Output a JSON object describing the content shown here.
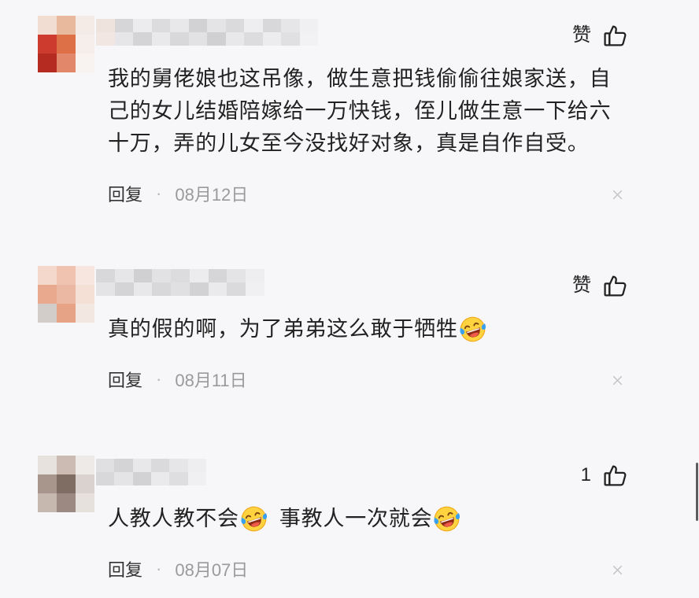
{
  "colors": {
    "background": "#f7f7f9",
    "text_primary": "#222222",
    "reply_label": "#333333",
    "text_secondary": "#9a9a9a",
    "separator": "#b5b5b5",
    "close_icon": "#c4c4c4",
    "scrollbar": "#5c5c5c"
  },
  "icons": {
    "like": "thumbs-up-icon",
    "dismiss": "close-icon",
    "emoji": "laughing-crying-emoji-icon"
  },
  "comments": [
    {
      "avatar_mosaic": [
        "#f1ddd2",
        "#e8b99c",
        "#f4ebe7",
        "#cc3b2e",
        "#de7048",
        "#f6eeeb",
        "#b52b22",
        "#e3876a",
        "#f8f3f1"
      ],
      "username_mosaic": [
        "#efe3de",
        "#d6d6d9",
        "#ececee",
        "#dcdcdf",
        "#e8e8ea",
        "#d2d2d5",
        "#e4e4e6",
        "#dadadd",
        "#eeeef0",
        "#d8d8db",
        "#e6e6e8",
        "#f0f0f2",
        "#f2e6e2",
        "#e6e6e8",
        "#d4d4d7",
        "#e9e9eb",
        "#d8d8db",
        "#e2e2e4",
        "#d0d0d3",
        "#e8e8ea",
        "#dcdcdf",
        "#ececee",
        "#e0e0e2",
        "#f2f2f4"
      ],
      "like_label": "赞",
      "text_lines": [
        "我的舅佬娘也这吊像，做生意把钱偷偷往娘家送，自",
        "己的女儿结婚陪嫁给一万快钱，侄儿做生意一下给六",
        "十万，弄的儿女至今没找好对象，真是自作自受。"
      ],
      "reply_label": "回复",
      "separator": "·",
      "date": "08月12日"
    },
    {
      "avatar_mosaic": [
        "#f4d8cc",
        "#efc3b0",
        "#f7e6df",
        "#e9a98e",
        "#ebb8a3",
        "#f5e0d6",
        "#d3cdca",
        "#e7a385",
        "#f3e7e1"
      ],
      "username_mosaic": [
        "#d8d8db",
        "#e6e6e8",
        "#d0d0d3",
        "#e2e2e4",
        "#dcdcdf",
        "#ececee",
        "#d6d6d9",
        "#e4e4e6",
        "#eeeef0",
        "#e4e4e6",
        "#d4d4d7",
        "#e8e8ea",
        "#d8d8db",
        "#e0e0e2",
        "#d2d2d5",
        "#eaeaec",
        "#dadadd",
        "#f0f0f2"
      ],
      "like_label": "赞",
      "text": "真的假的啊，为了弟弟这么敢于牺牲",
      "reply_label": "回复",
      "separator": "·",
      "date": "08月11日"
    },
    {
      "avatar_mosaic": [
        "#e8e2df",
        "#cbbbb3",
        "#eeeae8",
        "#a8958c",
        "#7f6d64",
        "#dad2ce",
        "#c6b7af",
        "#9c8a82",
        "#e7e1de"
      ],
      "username_mosaic": [
        "#e0e0e2",
        "#d4d4d7",
        "#e8e8ea",
        "#dadadd",
        "#e6e6e8",
        "#eeeef0",
        "#d8d8db",
        "#e4e4e6",
        "#d2d2d5",
        "#eaeaec",
        "#dedee0",
        "#f0f0f2"
      ],
      "like_count": "1",
      "text_parts": [
        "人教人教不会",
        "事教人一次就会"
      ],
      "reply_label": "回复",
      "separator": "·",
      "date": "08月07日"
    }
  ]
}
